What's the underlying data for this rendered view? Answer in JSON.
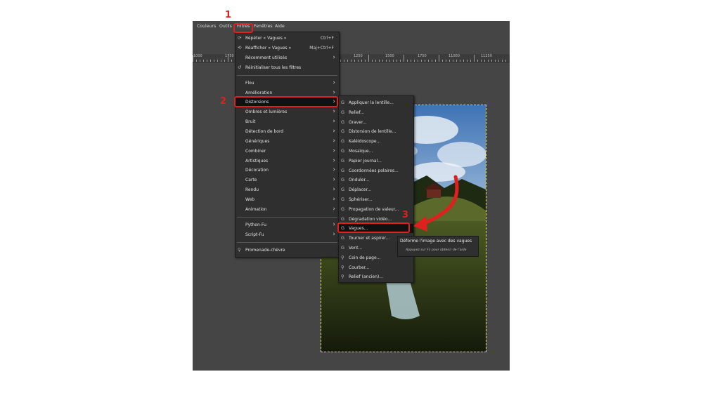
{
  "menubar": {
    "items": [
      "Couleurs",
      "Outils",
      "Filtres",
      "Fenêtres",
      "Aide"
    ]
  },
  "ruler": {
    "labels": [
      "1000",
      "1750",
      "1250",
      "1500",
      "1750",
      "11000",
      "11250"
    ]
  },
  "filters_menu": {
    "items": [
      {
        "label": "Répéter « Vagues »",
        "shortcut": "Ctrl+F",
        "icon": "repeat-filter-icon"
      },
      {
        "label": "Réafficher « Vagues »",
        "shortcut": "Maj+Ctrl+F",
        "icon": "reshow-filter-icon"
      },
      {
        "label": "Récemment utilisés",
        "submenu": true
      },
      {
        "label": "Réinitialiser tous les filtres",
        "icon": "reset-filters-icon"
      },
      {
        "label": "Flou",
        "submenu": true
      },
      {
        "label": "Amélioration",
        "submenu": true
      },
      {
        "label": "Distorsions",
        "submenu": true,
        "highlighted": true
      },
      {
        "label": "Ombres et lumières",
        "submenu": true
      },
      {
        "label": "Bruit",
        "submenu": true
      },
      {
        "label": "Détection de bord",
        "submenu": true
      },
      {
        "label": "Génériques",
        "submenu": true
      },
      {
        "label": "Combiner",
        "submenu": true
      },
      {
        "label": "Artistiques",
        "submenu": true
      },
      {
        "label": "Décoration",
        "submenu": true
      },
      {
        "label": "Carte",
        "submenu": true
      },
      {
        "label": "Rendu",
        "submenu": true
      },
      {
        "label": "Web",
        "submenu": true
      },
      {
        "label": "Animation",
        "submenu": true
      },
      {
        "label": "Python-Fu",
        "submenu": true
      },
      {
        "label": "Script-Fu",
        "submenu": true
      },
      {
        "label": "Promenade-chèvre",
        "icon": "goat-exercise-icon"
      }
    ]
  },
  "distortions_menu": {
    "items": [
      "Appliquer la lentille...",
      "Relief...",
      "Graver...",
      "Distorsion de lentille...",
      "Kaléidoscope...",
      "Mosaïque...",
      "Papier journal...",
      "Coordonnées polaires...",
      "Onduler...",
      "Déplacer...",
      "Sphériser...",
      "Propagation de valeur...",
      "Dégradation vidéo...",
      "Vagues...",
      "Tourner et aspirer...",
      "Vent...",
      "Coin de page...",
      "Courber...",
      "Relief (ancien)..."
    ],
    "highlighted_index": 13
  },
  "tooltip": {
    "text": "Déforme l'image avec des vagues",
    "hint": "Appuyez sur F1 pour obtenir de l'aide"
  },
  "callouts": [
    "1",
    "2",
    "3"
  ],
  "colors": {
    "accent": "#e01f1f",
    "menu_bg": "#2f2f2f",
    "app_bg": "#454545"
  }
}
